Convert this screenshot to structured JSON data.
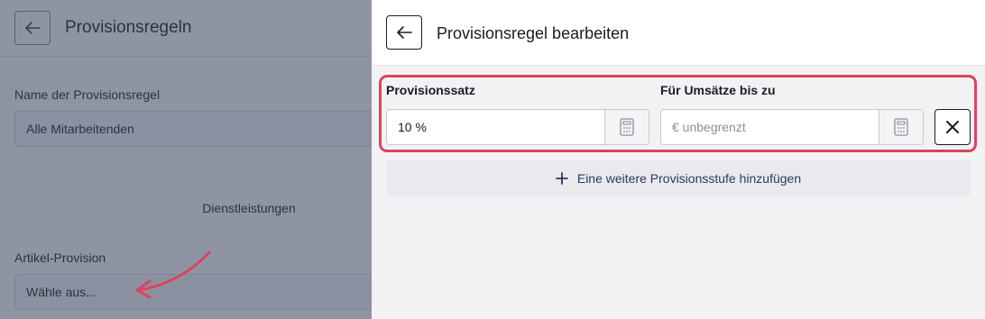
{
  "background": {
    "title": "Provisionsregeln",
    "name_label": "Name der Provisionsregel",
    "name_value": "Alle Mitarbeitenden",
    "section_label": "Dienstleistungen",
    "article_label": "Artikel-Provision",
    "article_placeholder": "Wähle aus..."
  },
  "panel": {
    "title": "Provisionsregel bearbeiten",
    "rate_label": "Provisionssatz",
    "rate_value": "10 %",
    "limit_label": "Für Umsätze bis zu",
    "limit_placeholder": "€ unbegrenzt",
    "add_tier_label": "Eine weitere Provisionsstufe hinzufügen"
  },
  "colors": {
    "highlight": "#d8465d",
    "annotation_arrow": "#d8465d"
  }
}
